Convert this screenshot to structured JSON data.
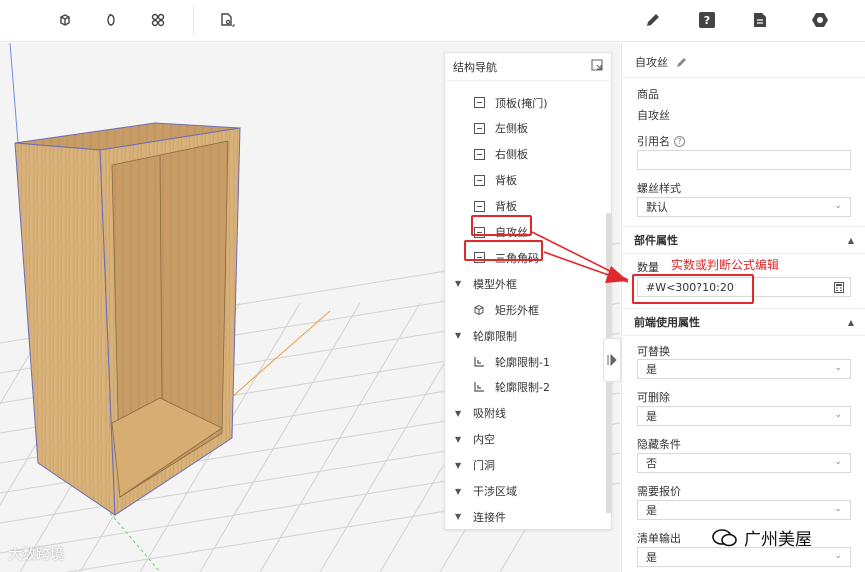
{
  "toolbar": {
    "left_icons": [
      "cube-view-icon",
      "rotate-icon",
      "link-icon",
      "document-tool-icon"
    ],
    "right_icons": [
      "pencil-icon",
      "help-icon",
      "file-icon",
      "settings-hex-icon"
    ],
    "help_glyph": "?"
  },
  "nav": {
    "title": "结构导航",
    "items": [
      {
        "label": "顶板(掩门)",
        "icon": "panel-icon",
        "level": "child"
      },
      {
        "label": "左侧板",
        "icon": "panel-icon",
        "level": "child"
      },
      {
        "label": "右侧板",
        "icon": "panel-icon",
        "level": "child"
      },
      {
        "label": "背板",
        "icon": "panel-icon",
        "level": "child"
      },
      {
        "label": "背板",
        "icon": "panel-icon",
        "level": "child"
      },
      {
        "label": "自攻丝",
        "icon": "panel-icon",
        "level": "child"
      },
      {
        "label": "三角角码",
        "icon": "panel-icon",
        "level": "child"
      },
      {
        "label": "模型外框",
        "icon": "caret-down-icon",
        "level": "group"
      },
      {
        "label": "矩形外框",
        "icon": "box-icon",
        "level": "child"
      },
      {
        "label": "轮廓限制",
        "icon": "caret-down-icon",
        "level": "group"
      },
      {
        "label": "轮廓限制-1",
        "icon": "outline-icon",
        "level": "child"
      },
      {
        "label": "轮廓限制-2",
        "icon": "outline-icon",
        "level": "child"
      },
      {
        "label": "吸附线",
        "icon": "caret-down-icon",
        "level": "group"
      },
      {
        "label": "内空",
        "icon": "caret-down-icon",
        "level": "group"
      },
      {
        "label": "门洞",
        "icon": "caret-down-icon",
        "level": "group"
      },
      {
        "label": "干涉区域",
        "icon": "caret-down-icon",
        "level": "group"
      },
      {
        "label": "连接件",
        "icon": "caret-down-icon",
        "level": "group"
      }
    ]
  },
  "props": {
    "title": "自攻丝",
    "goods_label": "商品",
    "goods_value": "自攻丝",
    "ref_label": "引用名",
    "ref_value": "",
    "screw_style_label": "螺丝样式",
    "screw_style_value": "默认",
    "section_part": "部件属性",
    "qty_label": "数量",
    "qty_value": "#W<300?10:20",
    "section_frontend": "前端使用属性",
    "replaceable_label": "可替换",
    "replaceable_value": "是",
    "deletable_label": "可删除",
    "deletable_value": "是",
    "hide_cond_label": "隐藏条件",
    "hide_cond_value": "否",
    "need_quote_label": "需要报价",
    "need_quote_value": "是",
    "list_output_label": "清单输出",
    "list_output_value": "是"
  },
  "annotation": {
    "text": "实数或判断公式编辑",
    "color": "#e0282d"
  },
  "watermark": {
    "left": "大数跨境",
    "right": "广州美屋"
  }
}
